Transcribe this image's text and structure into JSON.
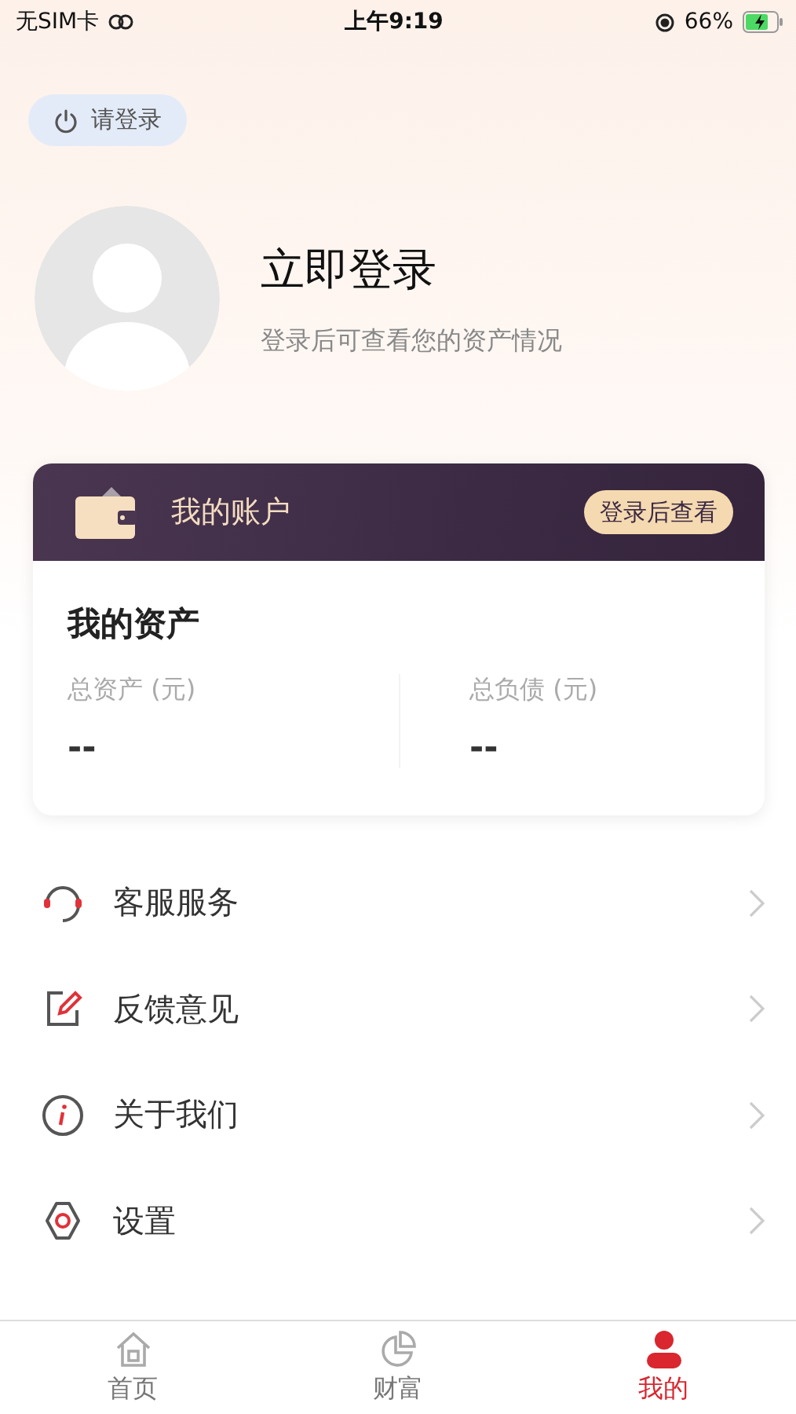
{
  "status_bar": {
    "carrier": "无SIM卡",
    "time": "上午9:19",
    "battery": "66%"
  },
  "login_button": {
    "label": "请登录"
  },
  "profile": {
    "title": "立即登录",
    "subtitle": "登录后可查看您的资产情况"
  },
  "account_card": {
    "title": "我的账户",
    "action": "登录后查看",
    "section_title": "我的资产",
    "stats": [
      {
        "label": "总资产 (元)",
        "value": "--"
      },
      {
        "label": "总负债 (元)",
        "value": "--"
      }
    ]
  },
  "menu": [
    {
      "kind": "service",
      "label": "客服服务"
    },
    {
      "kind": "feedback",
      "label": "反馈意见"
    },
    {
      "kind": "about",
      "label": "关于我们"
    },
    {
      "kind": "settings",
      "label": "设置"
    }
  ],
  "tabs": [
    {
      "kind": "home",
      "label": "首页",
      "selected": false
    },
    {
      "kind": "wealth",
      "label": "财富",
      "selected": false
    },
    {
      "kind": "mine",
      "label": "我的",
      "selected": true
    }
  ]
}
